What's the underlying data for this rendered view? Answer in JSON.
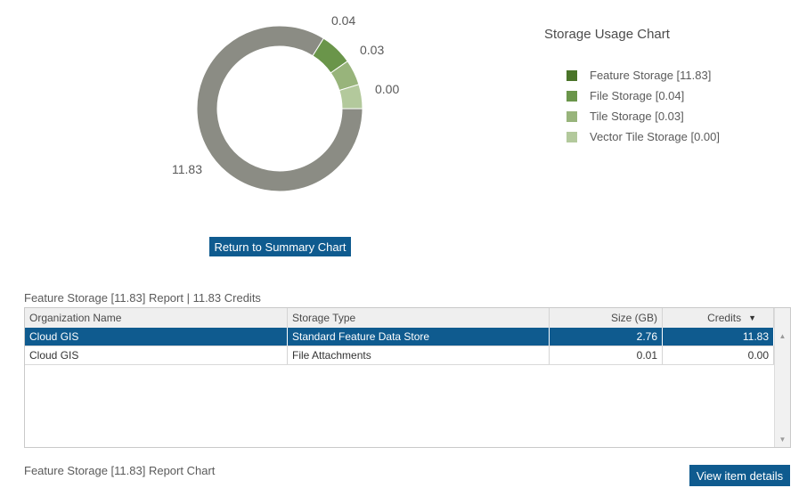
{
  "chart_data": {
    "type": "pie",
    "categories": [
      "Feature Storage",
      "File Storage",
      "Tile Storage",
      "Vector Tile Storage"
    ],
    "values": [
      11.83,
      0.04,
      0.03,
      0.0
    ],
    "value_labels": [
      "11.83",
      "0.04",
      "0.03",
      "0.00"
    ],
    "colors": [
      "#8b8c84",
      "#6a954a",
      "#98b47b",
      "#b3c99c"
    ],
    "legend_colors": [
      "#4a7429",
      "#6a954a",
      "#98b47b",
      "#b3c99c"
    ],
    "title": "Storage Usage Chart",
    "legend": [
      "Feature Storage [11.83]",
      "File Storage [0.04]",
      "Tile Storage [0.03]",
      "Vector Tile Storage [0.00]"
    ],
    "legend_position": "right",
    "donut": true
  },
  "buttons": {
    "return_summary": "Return to Summary Chart",
    "view_details": "View item details"
  },
  "report": {
    "title": "Feature Storage [11.83] Report | 11.83 Credits",
    "chart_title": "Feature Storage [11.83] Report Chart"
  },
  "table": {
    "headers": [
      "Organization Name",
      "Storage Type",
      "Size (GB)",
      "Credits"
    ],
    "sort_indicator": "▼",
    "rows": [
      [
        "Cloud GIS",
        "Standard Feature Data Store",
        "2.76",
        "11.83"
      ],
      [
        "Cloud GIS",
        "File Attachments",
        "0.01",
        "0.00"
      ]
    ]
  },
  "scrollbar": {
    "up": "▲",
    "down": "▼"
  }
}
